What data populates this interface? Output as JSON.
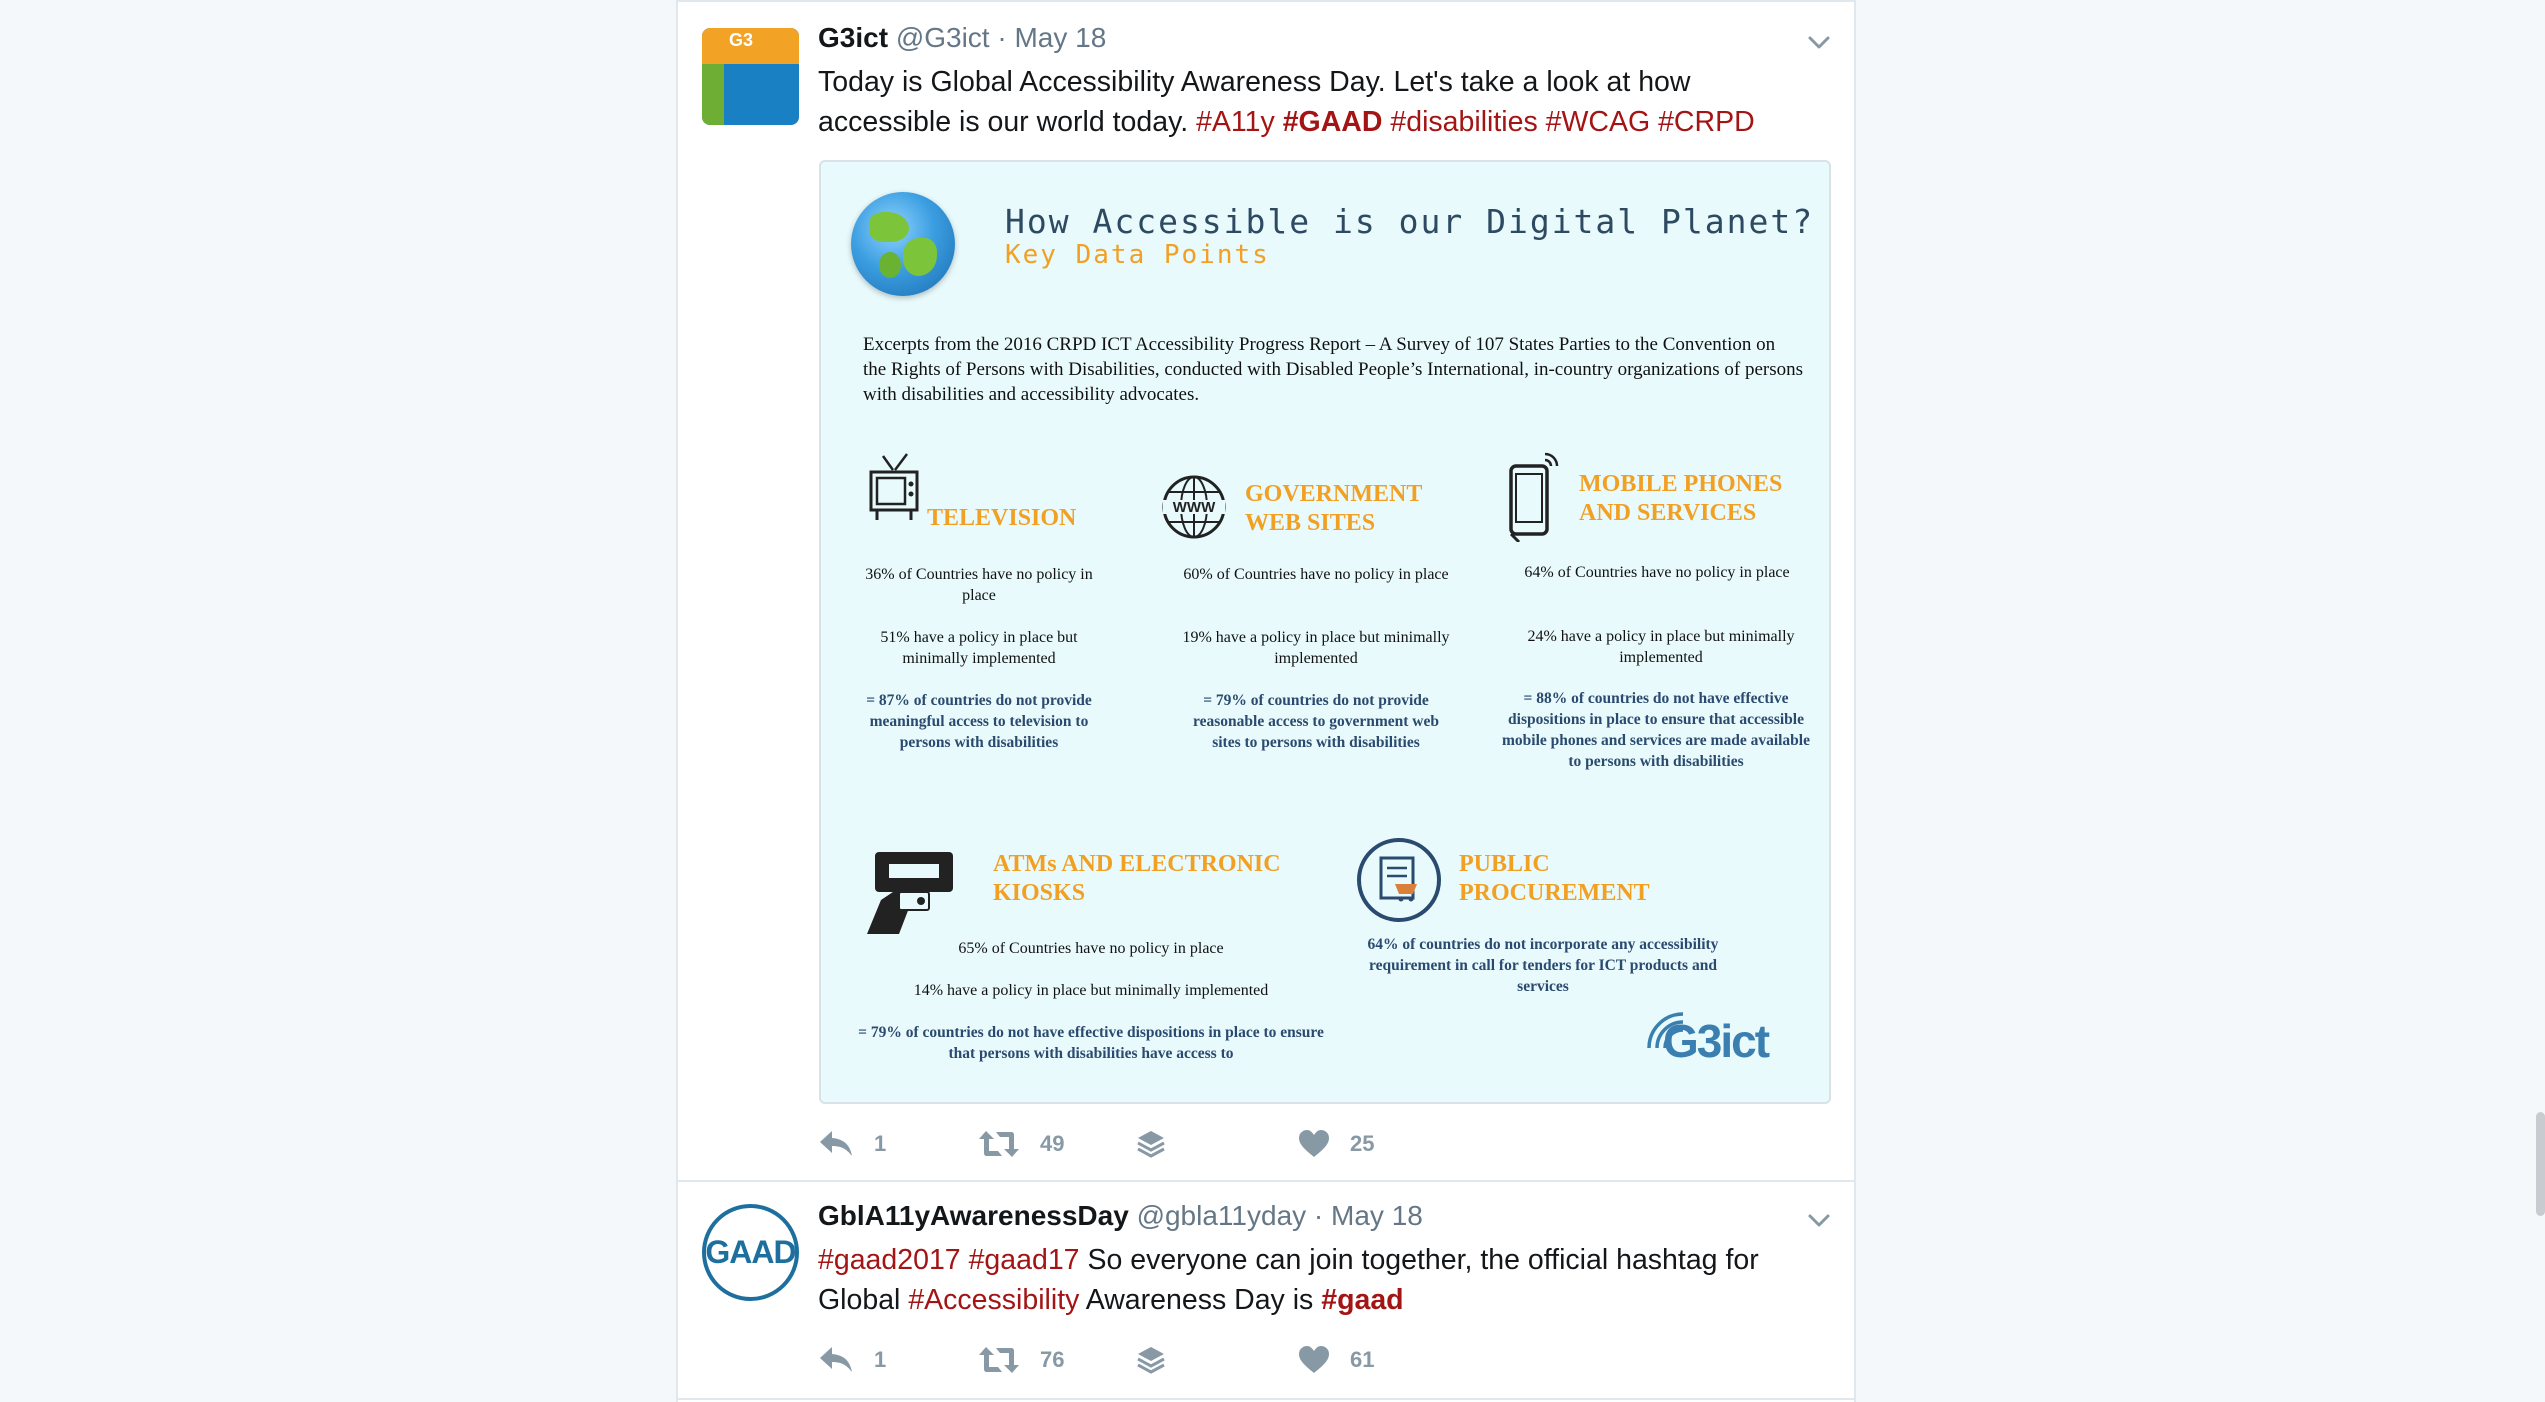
{
  "tweets": [
    {
      "name": "G3ict",
      "handle": "@G3ict",
      "separator": "·",
      "date": "May 18",
      "text_plain1": "Today is Global Accessibility Awareness Day. Let's take a look at how accessible is our world today. ",
      "hashtags": [
        "#A11y",
        "#GAAD",
        "#disabilities",
        "#WCAG",
        "#CRPD"
      ],
      "avatar_text": "G3",
      "media": {
        "title": "How Accessible is our Digital Planet?",
        "subtitle": "Key Data Points",
        "intro": "Excerpts from the 2016 CRPD ICT Accessibility Progress Report – A Survey of 107 States Parties to the Convention on the Rights of Persons with Disabilities, conducted with Disabled People’s International, in-country organizations of persons with disabilities and accessibility advocates.",
        "categories": [
          {
            "heading": "TELEVISION",
            "stat1": "36% of Countries have no policy in place",
            "stat2": "51% have a policy in place but minimally implemented",
            "conclusion": "= 87% of countries do not provide meaningful access to television to persons with disabilities"
          },
          {
            "heading": "GOVERNMENT WEB SITES",
            "stat1": "60% of Countries have no policy in place",
            "stat2": "19% have a policy in place but minimally implemented",
            "conclusion": "= 79% of countries do not provide reasonable access to government web sites to persons with disabilities"
          },
          {
            "heading": "MOBILE PHONES AND SERVICES",
            "stat1": "64% of Countries have no policy in place",
            "stat2": "24% have a policy in place but minimally implemented",
            "conclusion": "= 88% of countries do not have effective dispositions in place to ensure that accessible mobile phones and services are made available to persons with disabilities"
          },
          {
            "heading": "ATMs AND ELECTRONIC KIOSKS",
            "stat1": "65% of Countries have no policy in place",
            "stat2": "14% have a policy in place but minimally implemented",
            "conclusion": "= 79% of countries do not have effective dispositions in place to ensure that persons with disabilities have access to"
          },
          {
            "heading": "PUBLIC PROCUREMENT",
            "conclusion": "64% of countries do not incorporate any accessibility requirement in call for tenders for ICT products and services"
          }
        ],
        "logo_text": "G3ict"
      },
      "actions": {
        "replies": "1",
        "retweets": "49",
        "likes": "25"
      }
    },
    {
      "name": "GblA11yAwarenessDay",
      "handle": "@gbla11yday",
      "separator": "·",
      "date": "May 18",
      "hashtag1": "#gaad2017",
      "hashtag2": "#gaad17",
      "text_mid": " So everyone can join together, the official hashtag for Global ",
      "hashtag3": "#Accessibility",
      "text_mid2": " Awareness Day is ",
      "hashtag4": "#gaad",
      "avatar_text": "GAAD",
      "actions": {
        "replies": "1",
        "retweets": "76",
        "likes": "61"
      }
    }
  ],
  "icons": {
    "reply": "reply-icon",
    "retweet": "retweet-icon",
    "dm": "stack-icon",
    "like": "heart-icon",
    "caret": "chevron-down-icon"
  },
  "colors": {
    "hashtag": "#a31515",
    "muted": "#657786",
    "infographic_bg": "#e8fafc",
    "infographic_orange": "#f2a024",
    "infographic_navy": "#2b4a6f"
  }
}
